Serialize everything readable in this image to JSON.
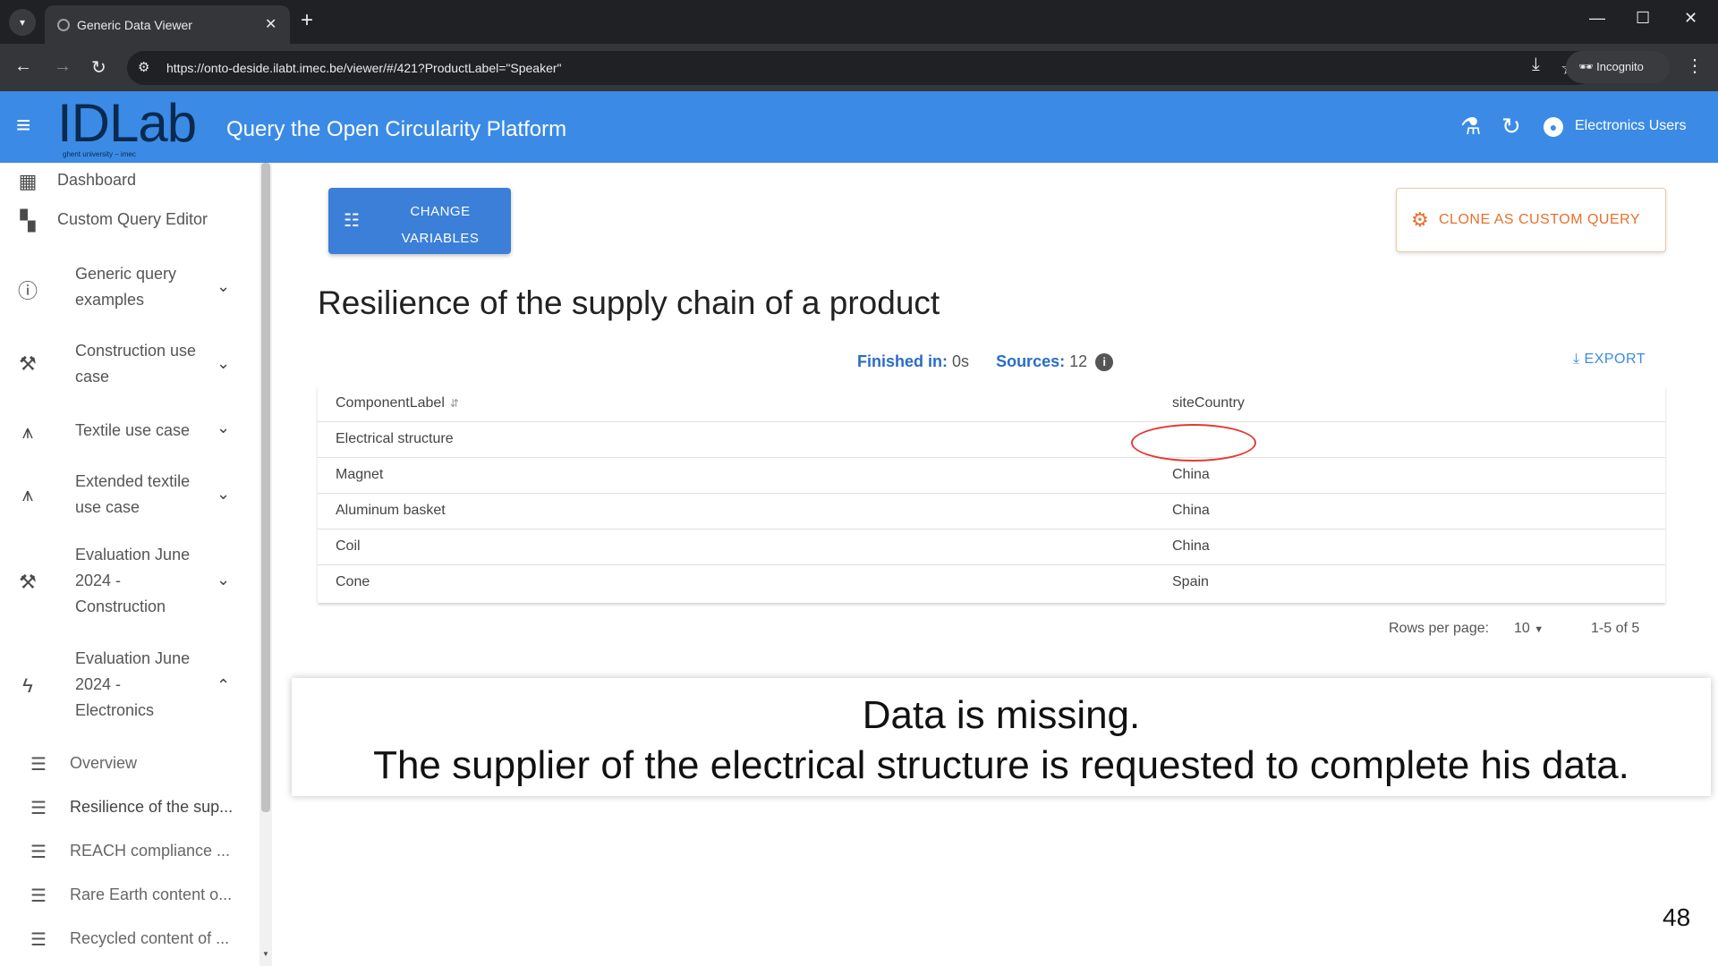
{
  "browser": {
    "tab_title": "Generic Data Viewer",
    "url": "https://onto-deside.ilabt.imec.be/viewer/#/421?ProductLabel=\"Speaker\"",
    "incognito_label": "Incognito"
  },
  "appbar": {
    "logo_text": "IDLab",
    "logo_sub": "ghent university – imec",
    "title": "Query the Open Circularity Platform",
    "user_name": "Electronics Users"
  },
  "sidebar": {
    "items": [
      {
        "label": "Dashboard",
        "icon": "dashboard-icon"
      },
      {
        "label": "Custom Query Editor",
        "icon": "grid-add-icon"
      },
      {
        "label_lines": [
          "Generic query",
          "examples"
        ],
        "icon": "info-icon",
        "expanded": false
      },
      {
        "label_lines": [
          "Construction use",
          "case"
        ],
        "icon": "construction-icon",
        "expanded": false
      },
      {
        "label": "Textile use case",
        "icon": "hanger-icon",
        "expanded": false
      },
      {
        "label_lines": [
          "Extended textile",
          "use case"
        ],
        "icon": "hanger-icon",
        "expanded": false
      },
      {
        "label_lines": [
          "Evaluation June",
          "2024 -",
          "Construction"
        ],
        "icon": "construction-icon",
        "expanded": false
      },
      {
        "label_lines": [
          "Evaluation June",
          "2024 -",
          "Electronics"
        ],
        "icon": "bolt-icon",
        "expanded": true
      }
    ],
    "subitems": [
      "Overview",
      "Resilience of the sup...",
      "REACH compliance ...",
      "Rare Earth content o...",
      "Recycled content of ..."
    ]
  },
  "main": {
    "change_variables_lines": [
      "CHANGE",
      "VARIABLES"
    ],
    "clone_label": "CLONE AS CUSTOM QUERY",
    "page_title": "Resilience of the supply chain of a product",
    "finished_label": "Finished in:",
    "finished_value": "0s",
    "sources_label": "Sources:",
    "sources_value": "12",
    "export_label": "EXPORT",
    "table": {
      "headers": [
        "ComponentLabel",
        "siteCountry"
      ],
      "rows": [
        [
          "Electrical structure",
          ""
        ],
        [
          "Magnet",
          "China"
        ],
        [
          "Aluminum basket",
          "China"
        ],
        [
          "Coil",
          "China"
        ],
        [
          "Cone",
          "Spain"
        ]
      ]
    },
    "rows_per_page_label": "Rows per page:",
    "rows_per_page_value": "10",
    "pagination_range": "1-5 of 5"
  },
  "callout": {
    "line1": "Data is missing.",
    "line2": "The supplier of the electrical structure is requested to complete his data."
  },
  "slide_number": "48",
  "colors": {
    "appbar": "#3b8be6",
    "accent_orange": "#e8702a",
    "highlight_ring": "#e53935"
  }
}
